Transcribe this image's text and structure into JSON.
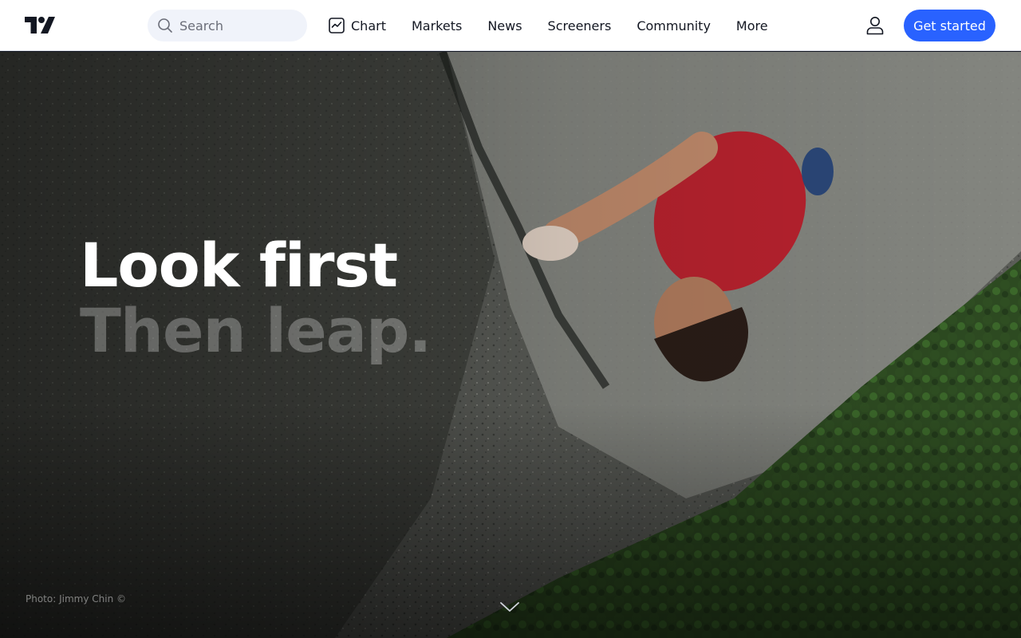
{
  "header": {
    "logo_icon": "tradingview-logo-icon",
    "search": {
      "placeholder": "Search",
      "icon": "search-icon"
    },
    "nav": [
      {
        "label": "Chart",
        "icon": "chart-icon"
      },
      {
        "label": "Markets"
      },
      {
        "label": "News"
      },
      {
        "label": "Screeners"
      },
      {
        "label": "Community"
      },
      {
        "label": "More"
      }
    ],
    "user_icon": "user-icon",
    "cta_label": "Get started"
  },
  "hero": {
    "headline_line1": "Look first",
    "headline_line2": "Then leap.",
    "photo_credit": "Photo: Jimmy Chin ©",
    "scroll_icon": "chevron-down-icon"
  },
  "colors": {
    "accent": "#2962ff",
    "text": "#131722",
    "search_bg": "#f0f3fa"
  }
}
